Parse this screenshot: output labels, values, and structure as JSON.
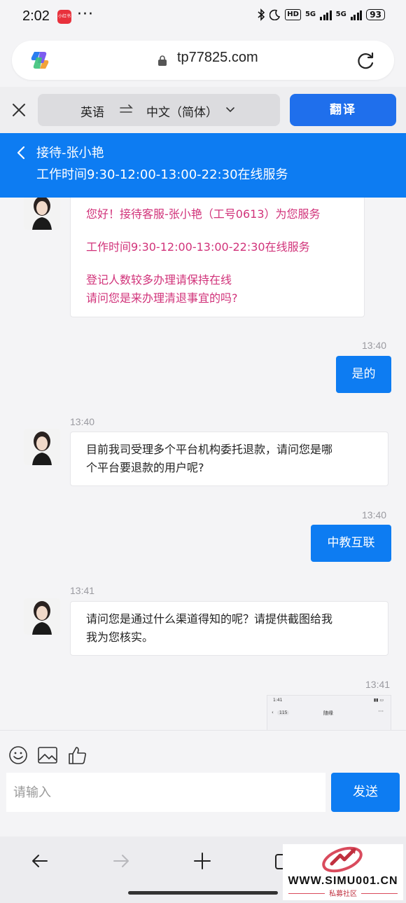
{
  "status_bar": {
    "time": "2:02",
    "app_badge": "小红书",
    "dots": "···",
    "hd": "HD",
    "net1": "5G",
    "net2": "5G",
    "battery": "93"
  },
  "browser": {
    "url": "tp77825.com",
    "icons": [
      "copilot-icon",
      "lock-icon",
      "reload-icon"
    ]
  },
  "translate_bar": {
    "source_lang": "英语",
    "target_lang": "中文（简体）",
    "translate_label": "翻译"
  },
  "chat_header": {
    "title": "接待-张小艳",
    "hours": "工作时间9:30-12:00-13:00-22:30在线服务"
  },
  "messages": {
    "welcome": {
      "line1": "您好！接待客服-张小艳（工号0613）为您服务",
      "line2": "工作时间9:30-12:00-13:00-22:30在线服务",
      "line3": "登记人数较多办理请保持在线",
      "line4": "请问您是来办理清退事宜的吗?"
    },
    "m1": {
      "time": "13:40",
      "text": "是的"
    },
    "m2": {
      "time": "13:40",
      "line1": "目前我司受理多个平台机构委托退款，请问您是哪",
      "line2": "个平台要退款的用户呢?"
    },
    "m3": {
      "time": "13:40",
      "text": "中教互联"
    },
    "m4": {
      "time": "13:41",
      "line1": "请问您是通过什么渠道得知的呢？请提供截图给我",
      "line2": "我为您核实。"
    },
    "m5": {
      "time": "13:41"
    },
    "thumbnail": {
      "status_time": "1:41",
      "back_count": "115",
      "contact_name": "随缘",
      "more": "···"
    }
  },
  "composer": {
    "placeholder": "请输入",
    "send_label": "发送",
    "tools": [
      "emoji-icon",
      "image-icon",
      "thumbs-up-icon"
    ]
  },
  "bottom_nav": {
    "items": [
      "back-arrow-icon",
      "forward-arrow-icon",
      "new-tab-icon",
      "tabs-icon"
    ]
  },
  "watermark": {
    "site": "WWW.SIMU001.CN",
    "subtitle": "私募社区"
  },
  "colors": {
    "accent": "#0d7cf2",
    "translate_button": "#1f6fec",
    "welcome_text": "#d1337a",
    "background": "#f4f4f6"
  }
}
